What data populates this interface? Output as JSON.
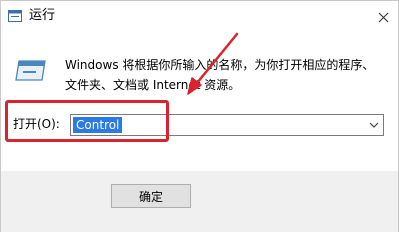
{
  "window": {
    "title": "运行",
    "title_icon": "run-app-icon",
    "close_icon": "close-icon"
  },
  "description": {
    "line1": "Windows 将根据你所输入的名称，为你打开相应的程序、",
    "line2": "文件夹、文档或 Internet 资源。"
  },
  "open_field": {
    "label": "打开(O):",
    "value": "Control",
    "dropdown_icon": "chevron-down-icon"
  },
  "footer": {
    "ok_label": "确定"
  },
  "colors": {
    "selection": "#2c7be5",
    "annotation": "#d9232e",
    "footer_bg": "#f0f0f0"
  }
}
